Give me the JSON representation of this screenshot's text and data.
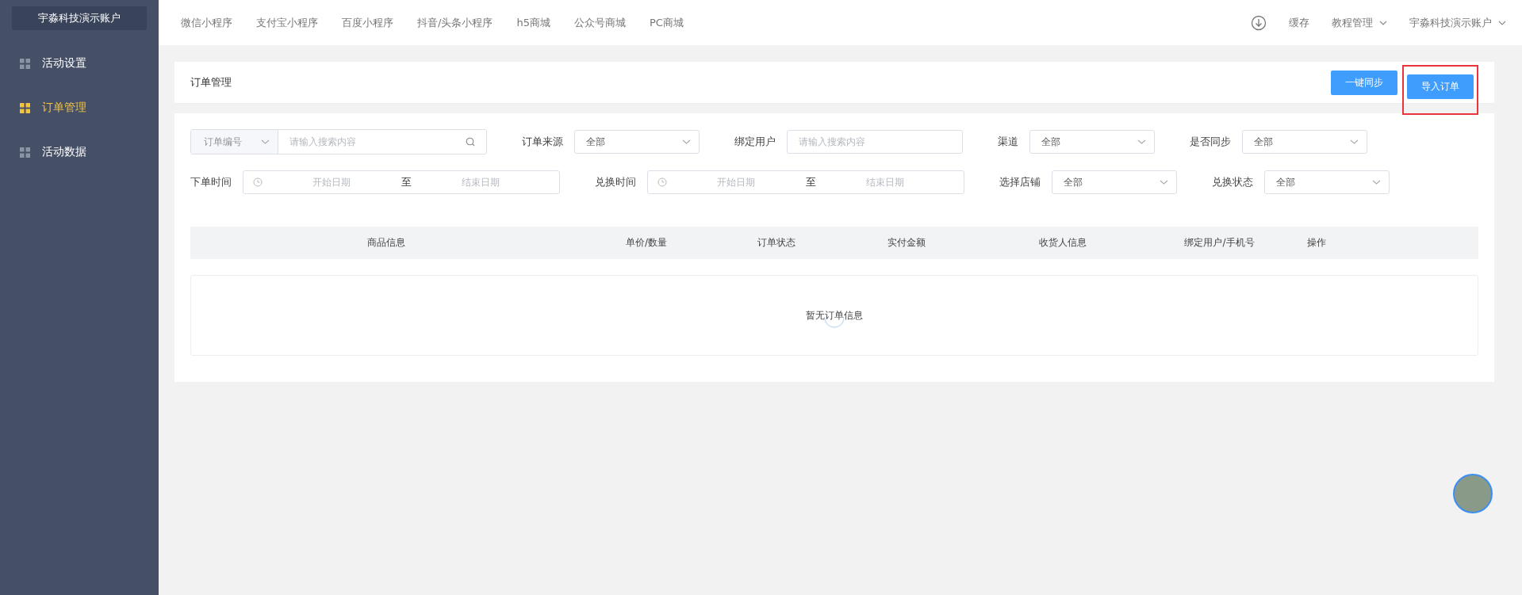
{
  "sidebar": {
    "account": "宇淼科技演示账户",
    "items": [
      {
        "label": "活动设置",
        "selected": false
      },
      {
        "label": "订单管理",
        "selected": true
      },
      {
        "label": "活动数据",
        "selected": false
      }
    ]
  },
  "top_nav": {
    "links": [
      "微信小程序",
      "支付宝小程序",
      "百度小程序",
      "抖音/头条小程序",
      "h5商城",
      "公众号商城",
      "PC商城"
    ],
    "right": [
      {
        "kind": "download"
      },
      {
        "kind": "link",
        "label": "缓存"
      },
      {
        "kind": "dropdown",
        "label": "教程管理"
      },
      {
        "kind": "dropdown",
        "label": "宇淼科技演示账户"
      }
    ]
  },
  "page": {
    "title": "订单管理",
    "buttons": [
      {
        "label": "一键同步",
        "highlighted": false
      },
      {
        "label": "导入订单",
        "highlighted": true
      }
    ]
  },
  "filters": [
    [
      {
        "kind": "compound",
        "select": "订单编号",
        "placeholder": "请输入搜索内容"
      },
      {
        "kind": "select",
        "label": "订单来源",
        "value": "全部"
      },
      {
        "kind": "input",
        "label": "绑定用户",
        "placeholder": "请输入搜索内容"
      },
      {
        "kind": "select",
        "label": "渠道",
        "value": "全部"
      },
      {
        "kind": "select",
        "label": "是否同步",
        "value": "全部"
      }
    ],
    [
      {
        "kind": "daterange",
        "label": "下单时间",
        "start": "开始日期",
        "sep": "至",
        "end": "结束日期"
      },
      {
        "kind": "daterange",
        "label": "兑换时间",
        "start": "开始日期",
        "sep": "至",
        "end": "结束日期"
      },
      {
        "kind": "select",
        "label": "选择店铺",
        "value": "全部"
      },
      {
        "kind": "select",
        "label": "兑换状态",
        "value": "全部"
      }
    ]
  ],
  "table": {
    "columns": [
      "商品信息",
      "单价/数量",
      "订单状态",
      "实付金额",
      "收货人信息",
      "绑定用户/手机号",
      "操作"
    ],
    "empty": "暂无订单信息",
    "loading": true
  }
}
